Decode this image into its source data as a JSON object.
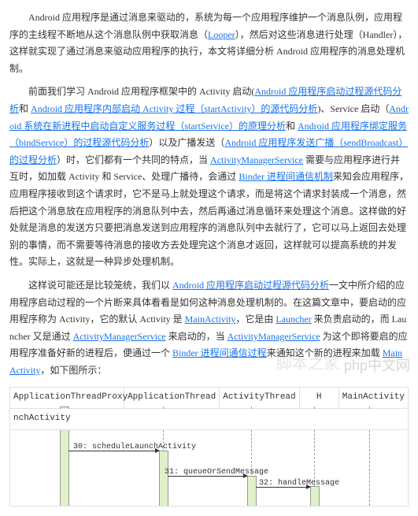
{
  "para1": {
    "t1": "Android 应用程序是通过消息来驱动的，系统为每一个应用程序维护一个消息队例，应用程序的主线程不断地从这个消息队例中获取消息（",
    "l1": "Looper",
    "t2": "），然后对这些消息进行处理（Handler），这样就实现了通过消息来驱动应用程序的执行，本文将详细分析 Android 应用程序的消息处理机制。"
  },
  "para2": {
    "t1": "前面我们学习 Android 应用程序框架中的 Activity 启动(",
    "l1": "Android 应用程序启动过程源代码分析",
    "t2": "和 ",
    "l2": "Android 应用程序内部启动 Activity 过程（startActivity）的源代码分析",
    "t3": ")、Service 启动（",
    "l3": "Android 系统在新进程中启动自定义服务过程（startService）的原理分析",
    "t4": "和 ",
    "l4": "Android 应用程序绑定服务（bindService）的过程源代码分析",
    "t5": "）以及广播发送（",
    "l5": "Android 应用程序发送广播（sendBroadcast）的过程分析",
    "t6": "）时，它们都有一个共同的特点，当 ",
    "l6": "ActivityManagerService",
    "t7": " 需要与应用程序进行并互时，如加载 Activity 和 Service、处理广播待，会通过 ",
    "l7": "Binder 进程间通信机制",
    "t8": "来知会应用程序，应用程序接收到这个请求时，它不是马上就处理这个请求，而是将这个请求封装成一个消息，然后把这个消息放在应用程序的消息队列中去，然后再通过消息循环来处理这个消息。这样做的好处就是消息的发送方只要把消息发送到应用程序的消息队列中去就行了，它可以马上返回去处理别的事情，而不需要等待消息的接收方去处理完这个消息才返回，这样就可以提高系统的并发性。实际上，这就是一种异步处理机制。"
  },
  "para3": {
    "t1": "这样说可能还是比较笼统，我们以 ",
    "l1": "Android 应用程序启动过程源代码分析",
    "t2": "一文中所介绍的应用程序启动过程的一个片断来具体看看是如何这种消息处理机制的。在这篇文章中，要启动的应用程序称为 Activity，它的默认 Activity 是 ",
    "l2": "MainActivity",
    "t3": "，它是由 ",
    "l3": "Launcher",
    "t4": " 来负责启动的，而 Launcher 又是通过 ",
    "l4": "ActivityManagerService",
    "t5": " 来启动的，当 ",
    "l5": "ActivityManagerService",
    "t6": " 为这个即将要启的应用程序准备好新的进程后，便通过一个 ",
    "l6": "Binder 进程间通信过程",
    "t7": "来通知这个新的进程来加载 ",
    "l7": "MainActivity",
    "t8": "，如下图所示："
  },
  "diagram": {
    "headers": {
      "h0": "ApplicationThreadProxy",
      "h1": "ApplicationThread",
      "h2": "ActivityThread",
      "h3": "H",
      "h4": "MainActivity"
    },
    "row": "nchActivity",
    "msg1": "30: scheduleLaunchActivity",
    "msg2": "31: queueOrSendMessage",
    "msg3": "32: handleMessage"
  },
  "watermark1": "脚本之家",
  "watermark2": "php中文网"
}
